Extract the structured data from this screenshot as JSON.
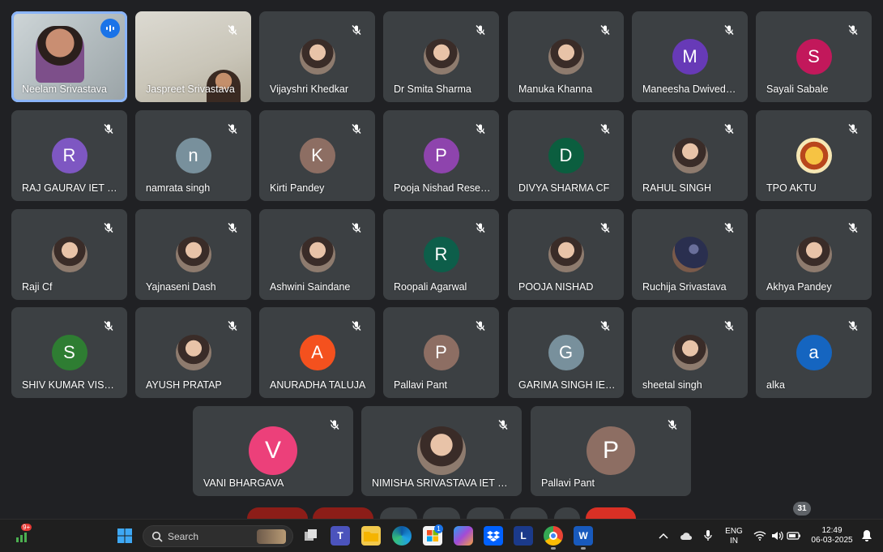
{
  "meeting": {
    "participants_row1": [
      {
        "name": "Neelam Srivastava",
        "state": "video",
        "active": true
      },
      {
        "name": "Jaspreet Srivastava",
        "state": "video2"
      },
      {
        "name": "Vijayshri Khedkar",
        "state": "photo"
      },
      {
        "name": "Dr Smita Sharma",
        "state": "photo"
      },
      {
        "name": "Manuka Khanna",
        "state": "photo"
      },
      {
        "name": "Maneesha Dwived…",
        "initial": "M",
        "color": "#673ab7"
      },
      {
        "name": "Sayali Sabale",
        "initial": "S",
        "color": "#c2185b"
      }
    ],
    "participants_row2": [
      {
        "name": "RAJ GAURAV IET L…",
        "initial": "R",
        "color": "#7e57c2"
      },
      {
        "name": "namrata singh",
        "initial": "n",
        "color": "#78909c"
      },
      {
        "name": "Kirti Pandey",
        "initial": "K",
        "color": "#8d6e63"
      },
      {
        "name": "Pooja Nishad Rese…",
        "initial": "P",
        "color": "#8e44ad"
      },
      {
        "name": "DIVYA SHARMA CF",
        "initial": "D",
        "color": "#0b5e3f"
      },
      {
        "name": "RAHUL SINGH",
        "state": "photo"
      },
      {
        "name": "TPO AKTU",
        "state": "logo"
      }
    ],
    "participants_row3": [
      {
        "name": "Raji Cf",
        "state": "photo"
      },
      {
        "name": "Yajnaseni Dash",
        "state": "photo"
      },
      {
        "name": "Ashwini Saindane",
        "state": "photo"
      },
      {
        "name": "Roopali Agarwal",
        "initial": "R",
        "color": "#0d5e4a"
      },
      {
        "name": "POOJA NISHAD",
        "state": "photo"
      },
      {
        "name": "Ruchija Srivastava",
        "state": "photo-night"
      },
      {
        "name": "Akhya Pandey",
        "state": "photo"
      }
    ],
    "participants_row4": [
      {
        "name": "SHIV KUMAR VISH…",
        "initial": "S",
        "color": "#2e7d32"
      },
      {
        "name": "AYUSH PRATAP",
        "state": "photo"
      },
      {
        "name": "ANURADHA TALUJA",
        "initial": "A",
        "color": "#f4511e"
      },
      {
        "name": "Pallavi Pant",
        "initial": "P",
        "color": "#8d6e63"
      },
      {
        "name": "GARIMA SINGH IE…",
        "initial": "G",
        "color": "#78909c"
      },
      {
        "name": "sheetal singh",
        "state": "photo"
      },
      {
        "name": "alka",
        "initial": "a",
        "color": "#1565c0"
      }
    ],
    "participants_row5": [
      {
        "name": "VANI BHARGAVA",
        "initial": "V",
        "color": "#ec407a"
      },
      {
        "name": "NIMISHA SRIVASTAVA IET St…",
        "state": "photo"
      },
      {
        "name": "Pallavi Pant",
        "initial": "P",
        "color": "#8d6e63"
      }
    ],
    "participant_count": "31"
  },
  "taskbar": {
    "search_label": "Search",
    "weather_badge": "9+",
    "lang_top": "ENG",
    "lang_bottom": "IN",
    "time": "12:49",
    "date": "06-03-2025",
    "teams_badge": "1"
  },
  "icons": [
    "mic-off-icon",
    "speaking-indicator-icon",
    "windows-start-icon",
    "search-icon",
    "chevron-up-icon",
    "cloud-icon",
    "wifi-icon",
    "speaker-icon",
    "battery-icon",
    "notification-icon"
  ]
}
